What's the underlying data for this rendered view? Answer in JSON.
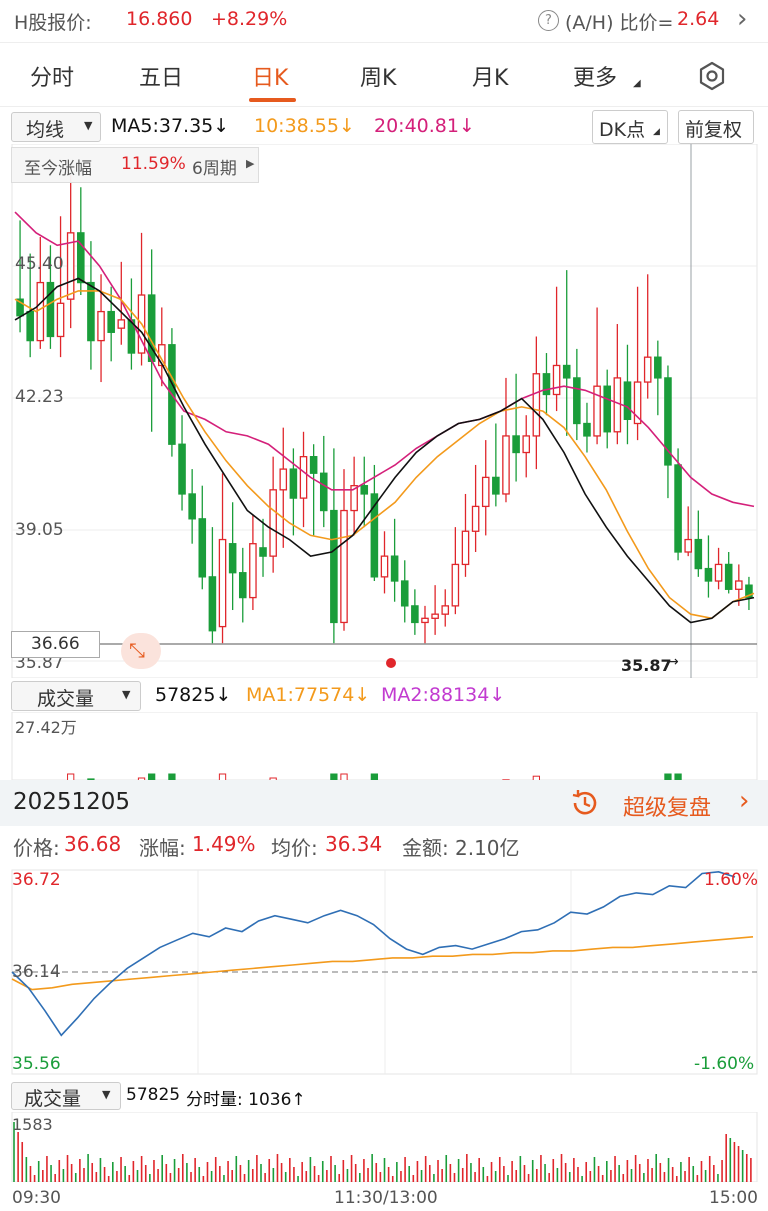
{
  "header": {
    "label": "H股报价:",
    "price": "16.860",
    "change": "+8.29%",
    "ah_label": "(A/H) 比价=",
    "ah_value": "2.64",
    "arrow": "›",
    "info_icon": "help-circle-icon"
  },
  "tabs": [
    "分时",
    "五日",
    "日K",
    "周K",
    "月K",
    "更多"
  ],
  "active_tab": "日K",
  "settings_icon": "gear-icon",
  "kline_bar": {
    "ma_select": "均线",
    "ma5": "MA5:37.35↓",
    "ma10": "10:38.55↓",
    "ma20": "20:40.81↓",
    "dk_button": "DK点",
    "adjust_button": "前复权"
  },
  "range_box": {
    "label": "至今涨幅",
    "value": "11.59%",
    "period": "6周期"
  },
  "kline_price_labels": [
    "45.40",
    "42.23",
    "39.05",
    "35.87"
  ],
  "current_price_tag": "36.66",
  "low_marker": "35.87",
  "volume_bar": {
    "select": "成交量",
    "value": "57825↓",
    "ma1": "MA1:77574↓",
    "ma2": "MA2:88134↓",
    "max_label": "27.42万"
  },
  "date_bar": {
    "date": "20251205",
    "replay_label": "超级复盘",
    "replay_icon": "history-clock-icon"
  },
  "intraday_info": {
    "price_label": "价格:",
    "price": "36.68",
    "change_label": "涨幅:",
    "change": "1.49%",
    "avg_label": "均价:",
    "avg": "36.34",
    "amount_label": "金额:",
    "amount": "2.10亿"
  },
  "intraday_axis": {
    "top": "36.72",
    "mid": "36.14",
    "bottom": "35.56",
    "top_pct": "1.60%",
    "bottom_pct": "-1.60%"
  },
  "intraday_volume": {
    "select": "成交量",
    "value": "57825",
    "min_label": "分时量: 1036↑",
    "max_label": "1583"
  },
  "time_axis": [
    "09:30",
    "11:30/13:00",
    "15:00"
  ],
  "colors": {
    "up": "#e0262b",
    "down": "#1a9d3a",
    "ma5": "#111111",
    "ma10": "#f39a1c",
    "ma20": "#d4207a",
    "price_line": "#2f6fb5",
    "avg_line": "#f39a1c",
    "accent": "#e65a1e"
  },
  "chart_data": [
    {
      "type": "candlestick",
      "title": "",
      "y_range": [
        35.87,
        45.4
      ],
      "ylabel": "",
      "candles": [
        [
          44.6,
          44.2,
          46.5,
          43.8
        ],
        [
          44.3,
          43.6,
          45.7,
          43.2
        ],
        [
          43.6,
          45.0,
          46.1,
          43.4
        ],
        [
          45.0,
          43.7,
          45.9,
          43.4
        ],
        [
          43.7,
          44.5,
          46.6,
          43.2
        ],
        [
          44.6,
          46.2,
          47.6,
          43.9
        ],
        [
          46.2,
          45.0,
          47.3,
          44.7
        ],
        [
          45.0,
          43.6,
          46.0,
          42.9
        ],
        [
          43.6,
          44.3,
          45.2,
          42.6
        ],
        [
          44.3,
          43.8,
          44.9,
          43.1
        ],
        [
          43.9,
          44.1,
          45.5,
          43.5
        ],
        [
          44.1,
          43.3,
          45.1,
          42.9
        ],
        [
          43.3,
          44.7,
          46.2,
          43.0
        ],
        [
          44.7,
          43.1,
          45.8,
          41.4
        ],
        [
          43.0,
          43.5,
          44.4,
          42.5
        ],
        [
          43.5,
          41.1,
          43.9,
          40.8
        ],
        [
          41.1,
          39.9,
          41.8,
          39.5
        ],
        [
          39.9,
          39.3,
          40.5,
          38.7
        ],
        [
          39.3,
          37.9,
          40.1,
          37.6
        ],
        [
          37.9,
          36.6,
          39.1,
          36.3
        ],
        [
          36.7,
          38.8,
          40.4,
          36.3
        ],
        [
          38.7,
          38.0,
          39.7,
          37.1
        ],
        [
          38.0,
          37.4,
          38.6,
          36.8
        ],
        [
          37.4,
          38.7,
          39.4,
          37.1
        ],
        [
          38.6,
          38.4,
          39.3,
          37.9
        ],
        [
          38.4,
          40.0,
          40.8,
          38.0
        ],
        [
          40.0,
          40.5,
          41.5,
          38.6
        ],
        [
          40.5,
          39.8,
          41.0,
          38.9
        ],
        [
          39.8,
          40.8,
          41.4,
          39.1
        ],
        [
          40.8,
          40.4,
          41.1,
          38.9
        ],
        [
          40.4,
          39.5,
          41.3,
          39.1
        ],
        [
          39.5,
          36.8,
          41.0,
          36.3
        ],
        [
          36.8,
          39.5,
          40.5,
          36.6
        ],
        [
          39.5,
          40.1,
          40.8,
          38.9
        ],
        [
          40.1,
          39.9,
          40.8,
          39.1
        ],
        [
          39.9,
          37.9,
          40.6,
          37.8
        ],
        [
          37.9,
          38.4,
          39.0,
          37.5
        ],
        [
          38.4,
          37.8,
          39.3,
          37.3
        ],
        [
          37.8,
          37.2,
          38.3,
          36.8
        ],
        [
          37.2,
          36.8,
          37.6,
          36.5
        ],
        [
          36.8,
          36.9,
          37.2,
          36.3
        ],
        [
          36.9,
          37.0,
          37.7,
          36.5
        ],
        [
          37.0,
          37.2,
          37.6,
          36.7
        ],
        [
          37.2,
          38.2,
          39.1,
          37.0
        ],
        [
          38.2,
          39.0,
          39.9,
          37.9
        ],
        [
          39.0,
          39.6,
          40.6,
          38.5
        ],
        [
          39.6,
          40.3,
          41.2,
          38.9
        ],
        [
          40.3,
          39.9,
          41.6,
          39.6
        ],
        [
          39.9,
          41.3,
          42.7,
          39.7
        ],
        [
          41.3,
          40.9,
          42.8,
          40.2
        ],
        [
          40.9,
          41.3,
          41.8,
          40.3
        ],
        [
          41.3,
          42.8,
          43.7,
          40.5
        ],
        [
          42.8,
          42.3,
          43.3,
          41.8
        ],
        [
          42.3,
          43.0,
          44.9,
          41.9
        ],
        [
          43.0,
          42.7,
          45.3,
          41.3
        ],
        [
          42.7,
          41.6,
          43.4,
          41.2
        ],
        [
          41.6,
          41.3,
          42.1,
          40.9
        ],
        [
          41.3,
          42.5,
          44.4,
          41.1
        ],
        [
          42.5,
          41.4,
          42.9,
          41.0
        ],
        [
          41.4,
          42.7,
          44.0,
          41.1
        ],
        [
          42.6,
          41.7,
          43.5,
          41.1
        ],
        [
          41.6,
          42.6,
          44.9,
          41.2
        ],
        [
          42.6,
          43.2,
          45.2,
          42.2
        ],
        [
          43.2,
          42.7,
          43.6,
          41.8
        ],
        [
          42.7,
          40.6,
          43.0,
          39.8
        ],
        [
          40.6,
          38.5,
          41.0,
          38.3
        ],
        [
          38.5,
          38.8,
          39.6,
          38.4
        ],
        [
          38.8,
          38.1,
          39.5,
          37.9
        ],
        [
          38.1,
          37.8,
          38.9,
          37.4
        ],
        [
          37.8,
          38.2,
          38.6,
          37.6
        ],
        [
          38.2,
          37.6,
          38.5,
          37.5
        ],
        [
          37.6,
          37.8,
          38.2,
          37.2
        ],
        [
          37.7,
          37.4,
          37.9,
          37.1
        ]
      ],
      "ma5": [
        44.1,
        44.4,
        44.9,
        45.1,
        44.8,
        44.3,
        43.8,
        43.0,
        42.0,
        41.1,
        40.3,
        39.5,
        39.1,
        38.8,
        38.4,
        38.5,
        38.9,
        39.6,
        40.3,
        40.9,
        41.3,
        41.6,
        41.7,
        41.9,
        42.2,
        41.7,
        40.9,
        39.9,
        39.1,
        38.4,
        37.8,
        37.2,
        36.8,
        36.9,
        37.3,
        37.4
      ],
      "ma10": [
        44.6,
        44.3,
        44.6,
        44.8,
        44.8,
        44.6,
        44.0,
        43.1,
        42.2,
        41.4,
        40.7,
        40.1,
        39.6,
        39.2,
        38.9,
        38.8,
        38.9,
        39.3,
        39.7,
        40.3,
        40.8,
        41.2,
        41.6,
        41.9,
        42.0,
        41.9,
        41.5,
        40.8,
        40.0,
        39.0,
        38.1,
        37.4,
        37.0,
        36.9,
        37.3,
        37.5
      ],
      "ma20": [
        46.7,
        46.2,
        45.9,
        46.0,
        45.4,
        44.6,
        43.6,
        42.6,
        41.9,
        41.7,
        41.4,
        41.3,
        41.1,
        40.7,
        40.3,
        40.0,
        40.0,
        40.3,
        40.6,
        41.0,
        41.3,
        41.6,
        41.7,
        41.9,
        42.2,
        42.4,
        42.5,
        42.4,
        42.2,
        42.0,
        41.5,
        40.9,
        40.3,
        39.9,
        39.7,
        39.6
      ]
    },
    {
      "type": "line",
      "title": "",
      "y_range": [
        35.56,
        36.72
      ],
      "x_labels": [
        "09:30",
        "11:30/13:00",
        "15:00"
      ],
      "series": [
        {
          "values": [
            36.14,
            36.05,
            35.92,
            35.78,
            35.88,
            35.99,
            36.08,
            36.16,
            36.22,
            36.28,
            36.32,
            36.36,
            36.34,
            36.39,
            36.37,
            36.43,
            36.46,
            36.44,
            36.42,
            36.46,
            36.49,
            36.46,
            36.41,
            36.33,
            36.27,
            36.24,
            36.28,
            36.29,
            36.27,
            36.3,
            36.33,
            36.37,
            36.38,
            36.42,
            36.48,
            36.47,
            36.51,
            36.57,
            36.59,
            36.58,
            36.63,
            36.62,
            36.7,
            36.71,
            36.68
          ]
        },
        {
          "values": [
            36.1,
            36.04,
            36.05,
            36.07,
            36.08,
            36.09,
            36.1,
            36.11,
            36.12,
            36.13,
            36.14,
            36.15,
            36.16,
            36.17,
            36.18,
            36.19,
            36.2,
            36.2,
            36.21,
            36.22,
            36.22,
            36.23,
            36.23,
            36.24,
            36.24,
            36.25,
            36.25,
            36.26,
            36.26,
            36.27,
            36.28,
            36.28,
            36.29,
            36.3,
            36.31,
            36.32,
            36.33,
            36.34
          ]
        }
      ]
    }
  ]
}
